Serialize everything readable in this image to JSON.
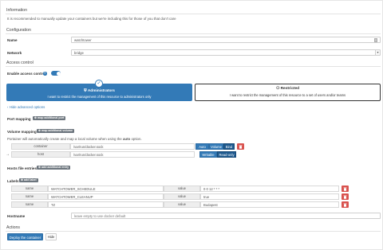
{
  "information": {
    "title": "Information",
    "text": "It is recommended to manually update your containers but we're including this for those of you that don't care"
  },
  "configuration": {
    "title": "Configuration",
    "name_label": "Name",
    "name_value": "watchtower",
    "network_label": "Network",
    "network_value": "bridge"
  },
  "access_control": {
    "title": "Access control",
    "enable_label": "Enable access control",
    "admin_title": "Administrators",
    "admin_desc": "I want to restrict the management of this resource to administrators only",
    "restricted_title": "Restricted",
    "restricted_desc": "I want to restrict the management of this resource to a set of users and/or teams",
    "advanced_link": "Hide advanced options"
  },
  "port_mapping": {
    "label": "Port mapping",
    "add_button": "map additional port"
  },
  "volume_mapping": {
    "label": "Volume mapping",
    "add_button": "map additional volume",
    "note_prefix": "Portainer will automatically create and map a local volume when using the ",
    "note_keyword": "auto",
    "note_suffix": " option.",
    "rows": [
      {
        "key": "container",
        "value": "/var/run/docker.sock",
        "options": [
          "Auto",
          "Volume",
          "Bind"
        ],
        "active": "Bind"
      },
      {
        "key": "host",
        "value": "/var/run/docker.sock",
        "options": [
          "Writable",
          "Read-only"
        ],
        "active": "Read-only"
      }
    ]
  },
  "hosts": {
    "label": "Hosts file entries",
    "add_button": "add additional entry"
  },
  "labels": {
    "label": "Labels",
    "add_button": "add label",
    "rows": [
      {
        "name_key": "name",
        "name": "WATCHTOWER_SCHEDULE",
        "value_key": "value",
        "value": "0 0 12 * * *"
      },
      {
        "name_key": "name",
        "name": "WATCHTOWER_CLEANUP",
        "value_key": "value",
        "value": "true"
      },
      {
        "name_key": "name",
        "name": "TZ",
        "value_key": "value",
        "value": "Budapest"
      }
    ]
  },
  "hostname": {
    "label": "Hostname",
    "placeholder": "leave empty to use docker default"
  },
  "actions": {
    "title": "Actions",
    "deploy": "Deploy the container",
    "hide": "Hide"
  },
  "colors": {
    "primary": "#337ab7",
    "danger": "#d9534f",
    "badge": "#6c757d"
  }
}
